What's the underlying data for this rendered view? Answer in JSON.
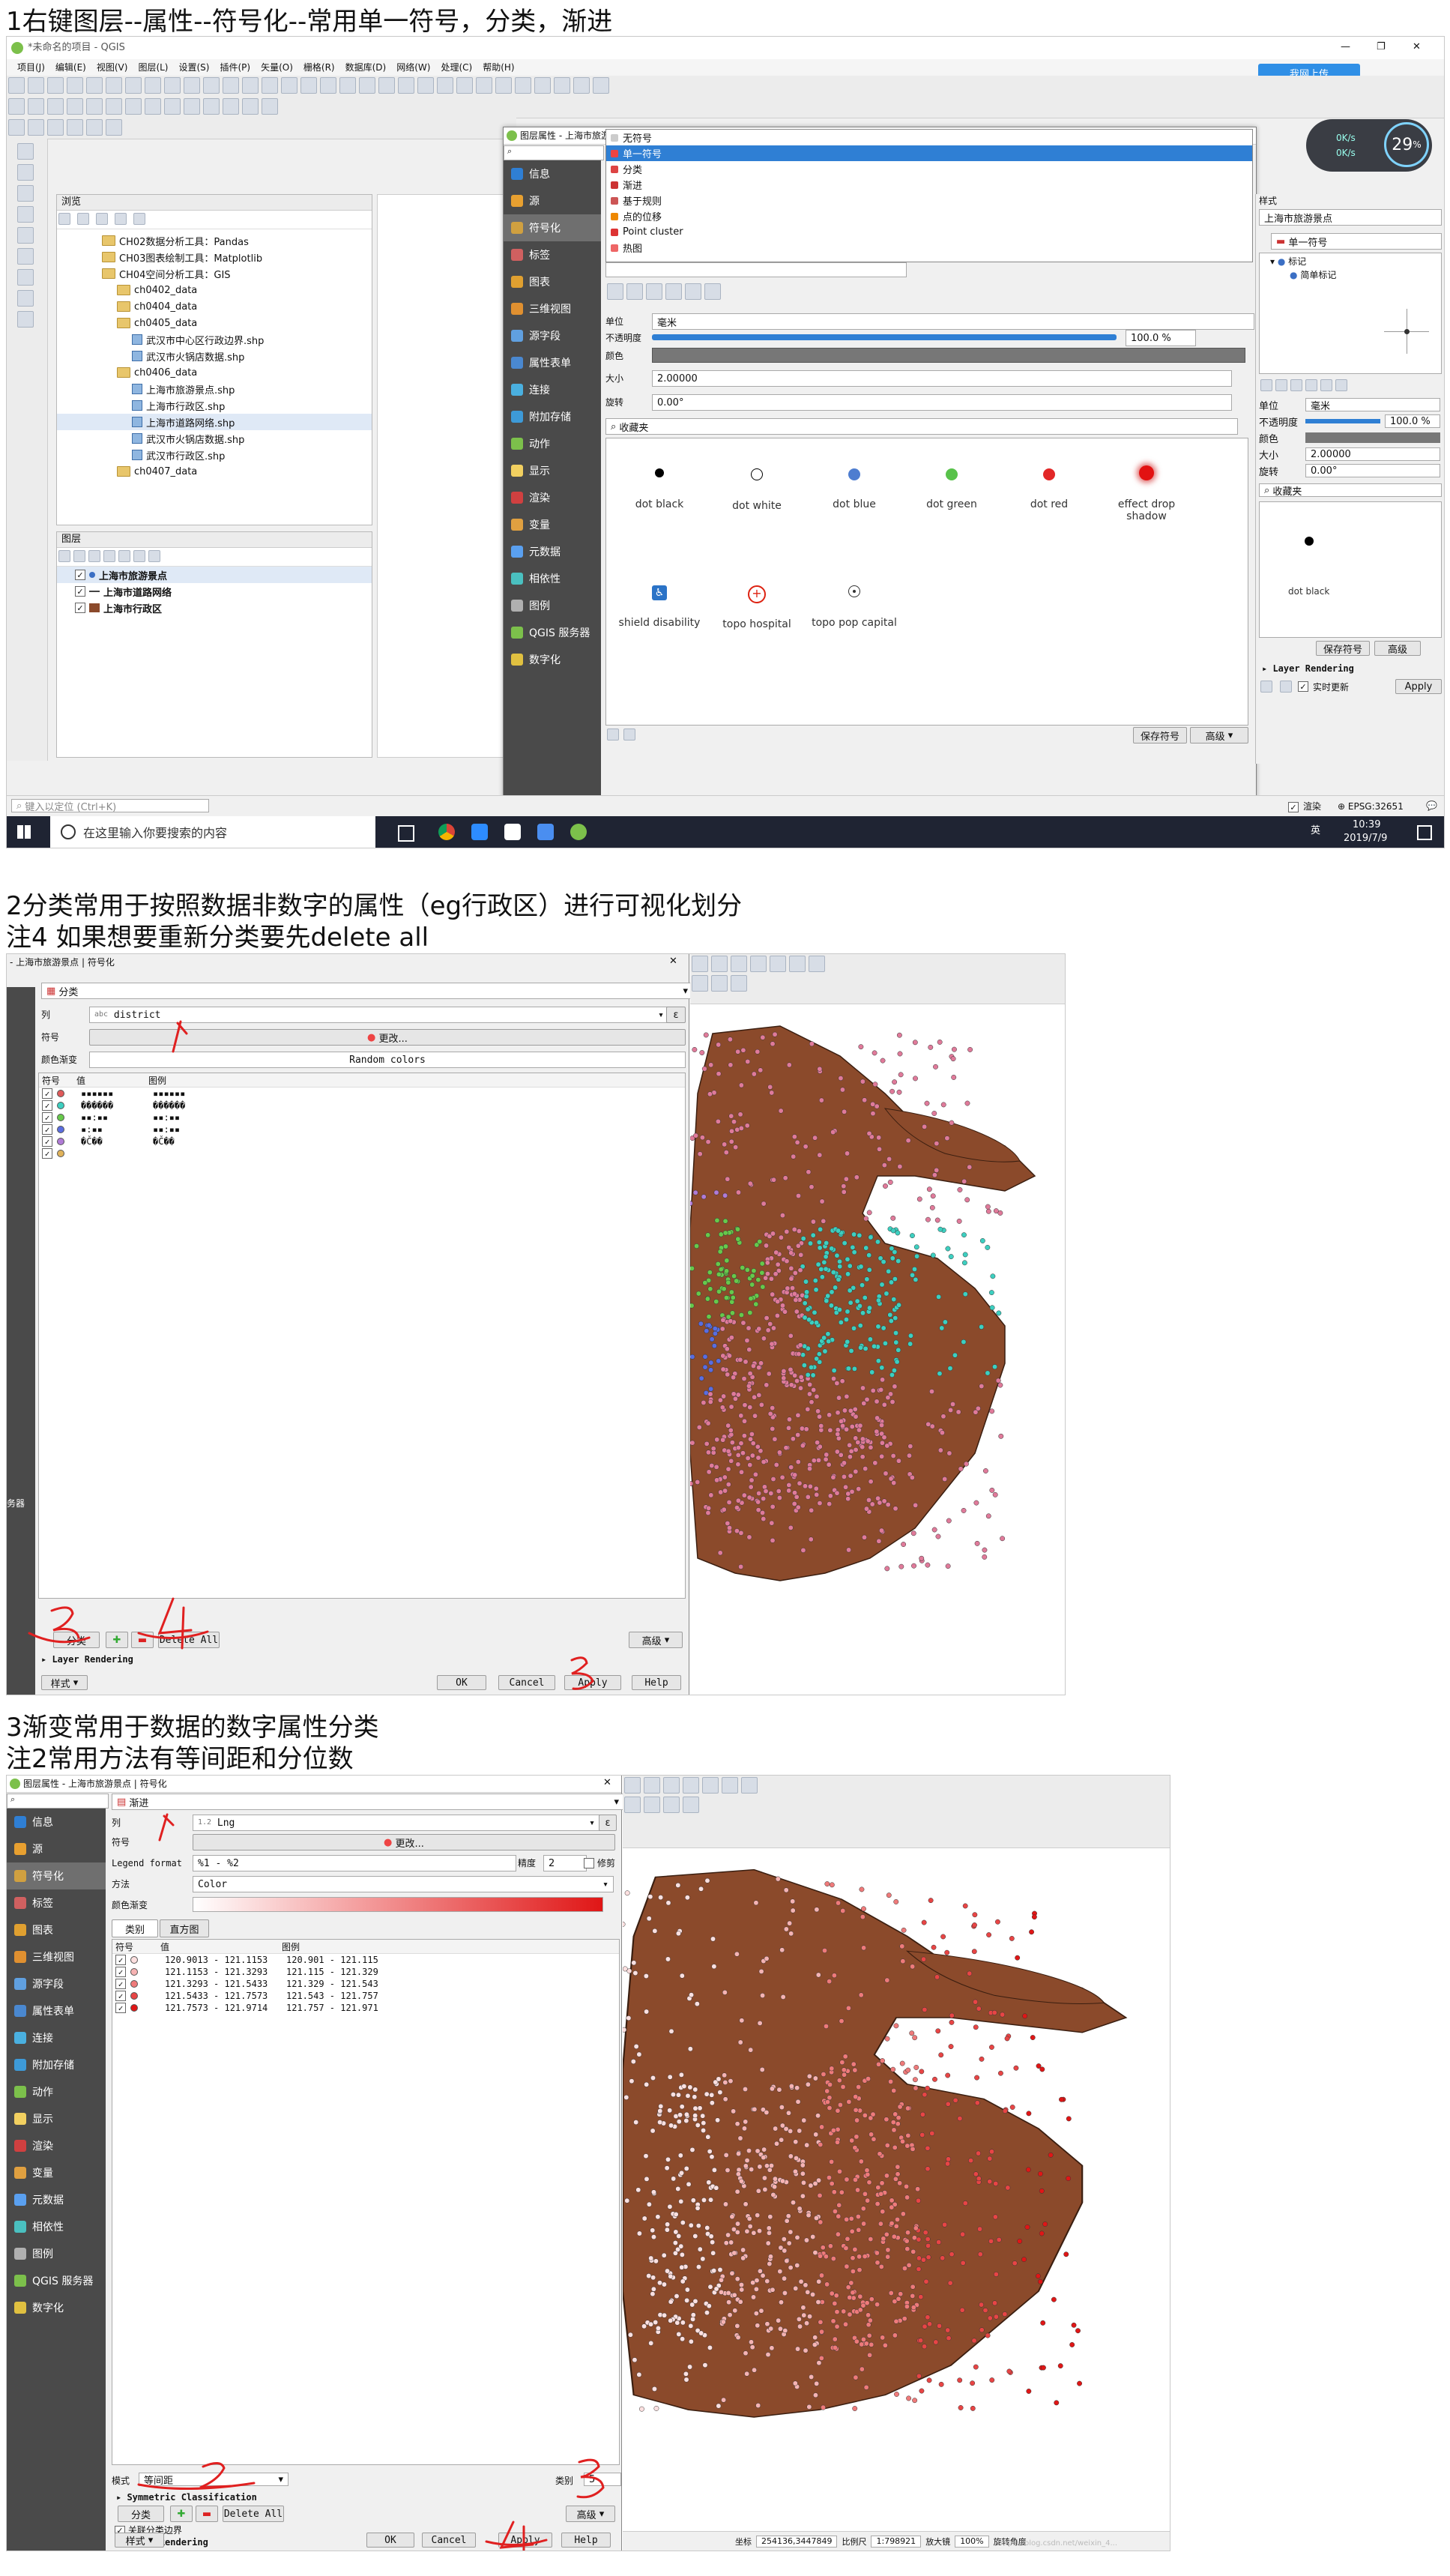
{
  "headings": {
    "h1": "1右键图层--属性--符号化--常用单一符号，分类，渐进",
    "h2a": "2分类常用于按照数据非数字的属性（eg行政区）进行可视化划分",
    "h2b": "注4 如果想要重新分类要先delete all",
    "h3a": "3渐变常用于数据的数字属性分类",
    "h3b": "注2常用方法有等间距和分位数"
  },
  "s1": {
    "window_title": "*未命名的项目 - QGIS",
    "menu": [
      "项目(J)",
      "编辑(E)",
      "视图(V)",
      "图层(L)",
      "设置(S)",
      "插件(P)",
      "矢量(O)",
      "栅格(R)",
      "数据库(D)",
      "网络(W)",
      "处理(C)",
      "帮助(H)"
    ],
    "baidu_btn": "我网上传",
    "browser_title": "浏览",
    "browser_items": [
      {
        "label": "CH02数据分析工具：Pandas",
        "type": "folder",
        "indent": 3
      },
      {
        "label": "CH03图表绘制工具：Matplotlib",
        "type": "folder",
        "indent": 3
      },
      {
        "label": "CH04空间分析工具：GIS",
        "type": "folder",
        "indent": 3
      },
      {
        "label": "ch0402_data",
        "type": "folder",
        "indent": 4
      },
      {
        "label": "ch0404_data",
        "type": "folder",
        "indent": 4
      },
      {
        "label": "ch0405_data",
        "type": "folder",
        "indent": 4
      },
      {
        "label": "武汉市中心区行政边界.shp",
        "type": "shp",
        "indent": 5
      },
      {
        "label": "武汉市火锅店数据.shp",
        "type": "shp",
        "indent": 5
      },
      {
        "label": "ch0406_data",
        "type": "folder",
        "indent": 4
      },
      {
        "label": "上海市旅游景点.shp",
        "type": "shp",
        "indent": 5
      },
      {
        "label": "上海市行政区.shp",
        "type": "shp",
        "indent": 5
      },
      {
        "label": "上海市道路网络.shp",
        "type": "shp",
        "indent": 5
      },
      {
        "label": "武汉市火锅店数据.shp",
        "type": "shp",
        "indent": 5
      },
      {
        "label": "武汉市行政区.shp",
        "type": "shp",
        "indent": 5
      },
      {
        "label": "ch0407_data",
        "type": "folder",
        "indent": 4
      }
    ],
    "layers_title": "图层",
    "layers": [
      "上海市旅游景点",
      "上海市道路网络",
      "上海市行政区"
    ],
    "dialog_title": "图层属性 - 上海市旅游景点 | 符号化",
    "side": [
      "信息",
      "源",
      "符号化",
      "标签",
      "图表",
      "三维视图",
      "源字段",
      "属性表单",
      "连接",
      "附加存储",
      "动作",
      "显示",
      "渲染",
      "变量",
      "元数据",
      "相依性",
      "图例",
      "QGIS 服务器",
      "数字化"
    ],
    "dropdown": [
      "无符号",
      "单一符号",
      "分类",
      "渐进",
      "基于规则",
      "点的位移",
      "Point cluster",
      "热图"
    ],
    "unit_label": "单位",
    "unit_value": "毫米",
    "opacity_label": "不透明度",
    "opacity_value": "100.0 %",
    "color_label": "颜色",
    "size_label": "大小",
    "size_value": "2.00000",
    "rotation_label": "旋转",
    "rotation_value": "0.00°",
    "favorites": "收藏夹",
    "symbols": [
      "dot black",
      "dot white",
      "dot blue",
      "dot green",
      "dot red",
      "effect drop shadow",
      "shield disability",
      "topo hospital",
      "topo pop capital"
    ],
    "save_symbol": "保存符号",
    "advanced": "高级",
    "styles_title": "样式",
    "styles_layer": "上海市旅游景点",
    "styles_mode": "单一符号",
    "marker": "标记",
    "simple_marker": "简单标记",
    "right_unit_value": "毫米",
    "right_opacity": "100.0 %",
    "right_size": "2.00000",
    "right_rotation": "0.00°",
    "right_fav": "收藏夹",
    "right_symbol": "dot black",
    "layer_rendering": "Layer Rendering",
    "live_update": "实时更新",
    "apply": "Apply",
    "status_search": "键入以定位 (Ctrl+K)",
    "render_label": "渲染",
    "crs": "EPSG:32651",
    "search_taskbar": "在这里输入你要搜索的内容",
    "time": "10:39",
    "date": "2019/7/9",
    "ime": "英",
    "net1": "0K/s",
    "net2": "0K/s",
    "gauge": "29",
    "gauge_unit": "%"
  },
  "s2": {
    "dialog_title": "- 上海市旅游景点 | 符号化",
    "mode": "分类",
    "column_label": "列",
    "column_value": "district",
    "column_prefix": "abc",
    "symbol_label": "符号",
    "symbol_change": "更改...",
    "ramp_label": "颜色渐变",
    "ramp_value": "Random colors",
    "col_headers": [
      "符号",
      "值",
      "图例"
    ],
    "rows": [
      {
        "color": "#e05a5a",
        "value": "▪▪▪▪▪▪",
        "legend": "▪▪▪▪▪▪"
      },
      {
        "color": "#3dcfc0",
        "value": "������",
        "legend": "������"
      },
      {
        "color": "#67c94b",
        "value": "▪▪:▪▪",
        "legend": "▪▪:▪▪"
      },
      {
        "color": "#5a6de0",
        "value": "▪:▪▪",
        "legend": "▪▪:▪▪"
      },
      {
        "color": "#b07bd6",
        "value": "�Č��",
        "legend": "�Č��"
      },
      {
        "color": "#e0b25a",
        "value": "",
        "legend": ""
      }
    ],
    "classify": "分类",
    "delete_all": "Delete All",
    "advanced": "高级",
    "layer_rendering": "Layer Rendering",
    "style": "样式",
    "ok": "OK",
    "cancel": "Cancel",
    "apply": "Apply",
    "help": "Help",
    "left_cut": "务器"
  },
  "s3": {
    "dialog_title": "图层属性 - 上海市旅游景点 | 符号化",
    "mode": "渐进",
    "column_label": "列",
    "column_value": "Lng",
    "column_prefix": "1.2",
    "symbol_label": "符号",
    "symbol_change": "更改...",
    "legend_format_label": "Legend format",
    "legend_format_value": "%1 - %2",
    "precision_label": "精度",
    "precision_value": "2",
    "trim_label": "修剪",
    "method_label": "方法",
    "method_value": "Color",
    "ramp_label": "颜色渐变",
    "tab_classes": "类别",
    "tab_hist": "直方图",
    "col_headers": [
      "符号",
      "值",
      "图例"
    ],
    "rows": [
      {
        "color": "#fde0e0",
        "value": "120.9013 - 121.1153",
        "legend": "120.901 - 121.115"
      },
      {
        "color": "#f6b3b3",
        "value": "121.1153 - 121.3293",
        "legend": "121.115 - 121.329"
      },
      {
        "color": "#ef7a7a",
        "value": "121.3293 - 121.5433",
        "legend": "121.329 - 121.543"
      },
      {
        "color": "#e84545",
        "value": "121.5433 - 121.7573",
        "legend": "121.543 - 121.757"
      },
      {
        "color": "#e01616",
        "value": "121.7573 - 121.9714",
        "legend": "121.757 - 121.971"
      }
    ],
    "mode_label": "模式",
    "mode_value": "等间距",
    "classes_label": "类别",
    "classes_value": "5",
    "symmetric": "Symmetric Classification",
    "classify": "分类",
    "delete_all": "Delete All",
    "advanced": "高级",
    "link_label": "关联分类边界",
    "layer_rendering": "Layer Rendering",
    "style": "样式",
    "ok": "OK",
    "cancel": "Cancel",
    "apply": "Apply",
    "help": "Help",
    "side": [
      "信息",
      "源",
      "符号化",
      "标签",
      "图表",
      "三维视图",
      "源字段",
      "属性表单",
      "连接",
      "附加存储",
      "动作",
      "显示",
      "渲染",
      "变量",
      "元数据",
      "相依性",
      "图例",
      "QGIS 服务器",
      "数字化"
    ],
    "coord_label": "坐标",
    "coord_value": "254136,3447849",
    "scale_label": "比例尺",
    "scale_value": "1:798921",
    "zoom_label": "放大镜",
    "zoom_value": "100%",
    "rot_label": "旋转角度",
    "watermark": "https://blog.csdn.net/weixin_4..."
  }
}
